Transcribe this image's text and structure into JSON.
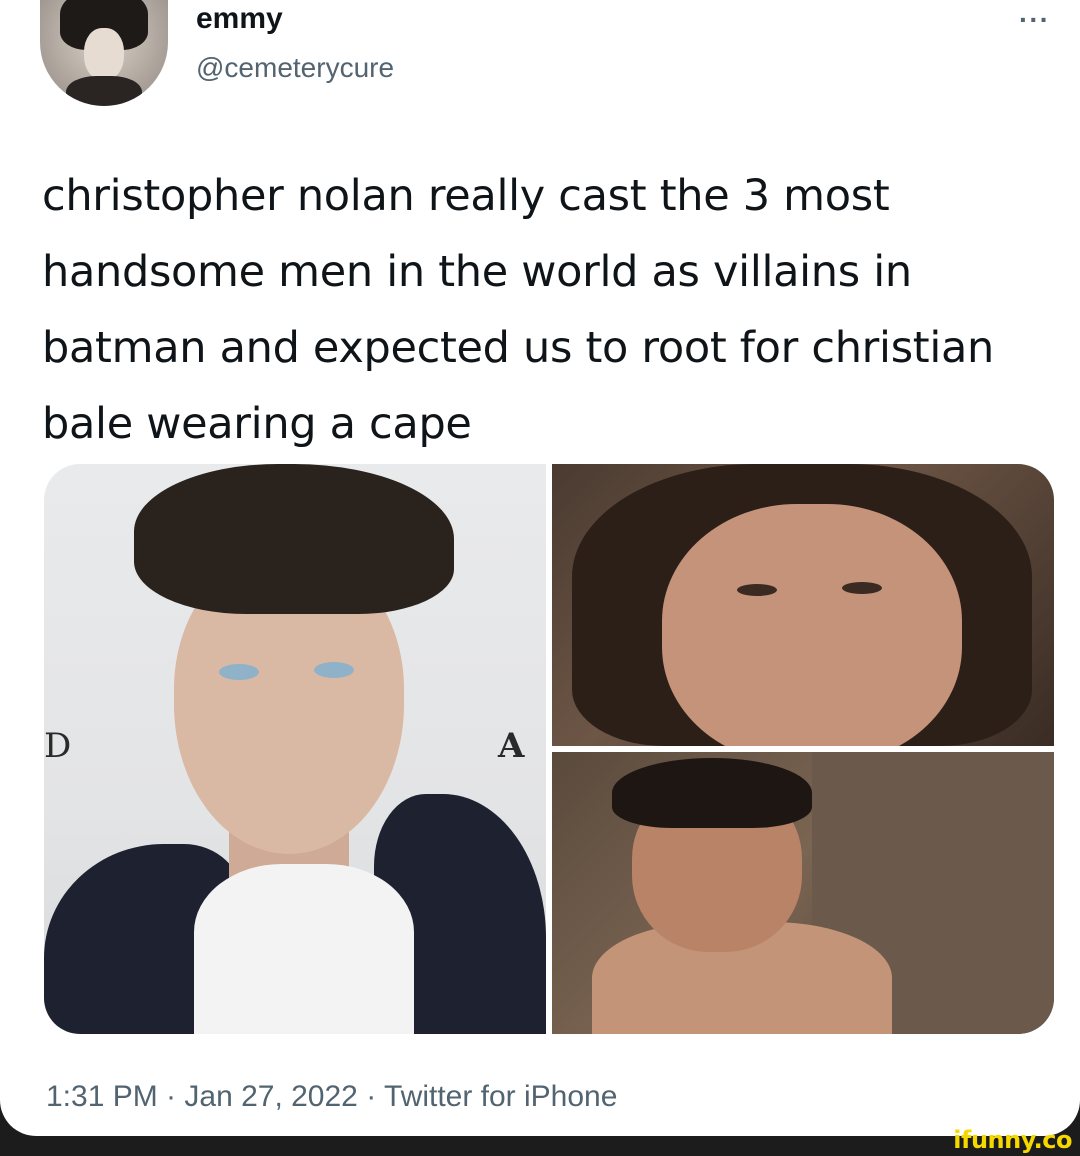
{
  "user": {
    "display_name": "emmy",
    "handle": "@cemeterycure"
  },
  "more_icon": "···",
  "tweet": {
    "text": "christopher nolan really cast the 3 most handsome men in the world as villains in batman and expected us to root for christian bale wearing a cape"
  },
  "media": {
    "photo1_sign_left": "D",
    "photo1_sign_right": "A"
  },
  "meta": {
    "timestamp": "1:31 PM · Jan 27, 2022 · Twitter for iPhone"
  },
  "watermark": "ifunny.co",
  "colors": {
    "text_primary": "#0f1419",
    "text_secondary": "#536471",
    "watermark": "#f5d800"
  }
}
